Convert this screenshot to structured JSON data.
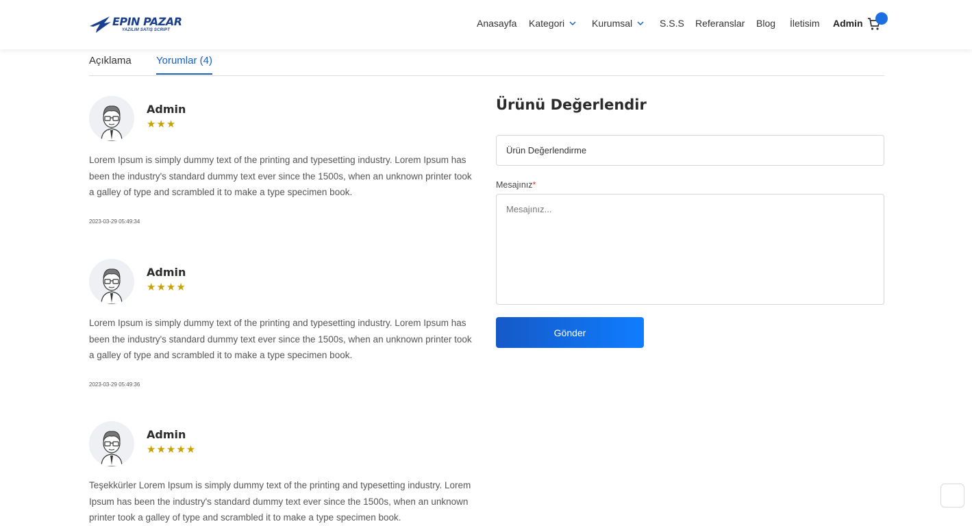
{
  "brand": {
    "name": "EPIN PAZAR",
    "tagline": "YAZILIM SATIŞ SCRIPT"
  },
  "nav": {
    "items": [
      {
        "label": "Anasayfa"
      },
      {
        "label": "Kategori"
      },
      {
        "label": "Kurumsal"
      },
      {
        "label": "S.S.S"
      },
      {
        "label": "Referanslar"
      },
      {
        "label": "Blog"
      },
      {
        "label": "İletisim"
      }
    ],
    "user_label": "Admin",
    "cart_icon": "cart-icon",
    "badge_color": "#1b6fe0"
  },
  "tabs": [
    {
      "label": "Açıklama",
      "active": false
    },
    {
      "label": "Yorumlar (4)",
      "active": true
    }
  ],
  "reviews": [
    {
      "author": "Admin",
      "stars": "★★★",
      "rating": 3,
      "text": "Lorem Ipsum is simply dummy text of the printing and typesetting industry. Lorem Ipsum has been the industry's standard dummy text ever since the 1500s, when an unknown printer took a galley of type and scrambled it to make a type specimen book.",
      "date": "2023-03-29 05:49:34"
    },
    {
      "author": "Admin",
      "stars": "★★★★",
      "rating": 4,
      "text": "Lorem Ipsum is simply dummy text of the printing and typesetting industry. Lorem Ipsum has been the industry's standard dummy text ever since the 1500s, when an unknown printer took a galley of type and scrambled it to make a type specimen book.",
      "date": "2023-03-29 05:49:36"
    },
    {
      "author": "Admin",
      "stars": "★★★★★",
      "rating": 5,
      "text": "Teşekkürler Lorem Ipsum is simply dummy text of the printing and typesetting industry. Lorem Ipsum has been the industry's standard dummy text ever since the 1500s, when an unknown printer took a galley of type and scrambled it to make a type specimen book."
    }
  ],
  "form": {
    "title": "Ürünü Değerlendir",
    "rating_select_value": "Ürün Değerlendirme",
    "message_label": "Mesajınız",
    "required_mark": "*",
    "message_placeholder": "Mesajınız...",
    "submit_label": "Gönder"
  },
  "colors": {
    "accent": "#1a5fc1",
    "star": "#c9a100",
    "required": "#e03131"
  }
}
